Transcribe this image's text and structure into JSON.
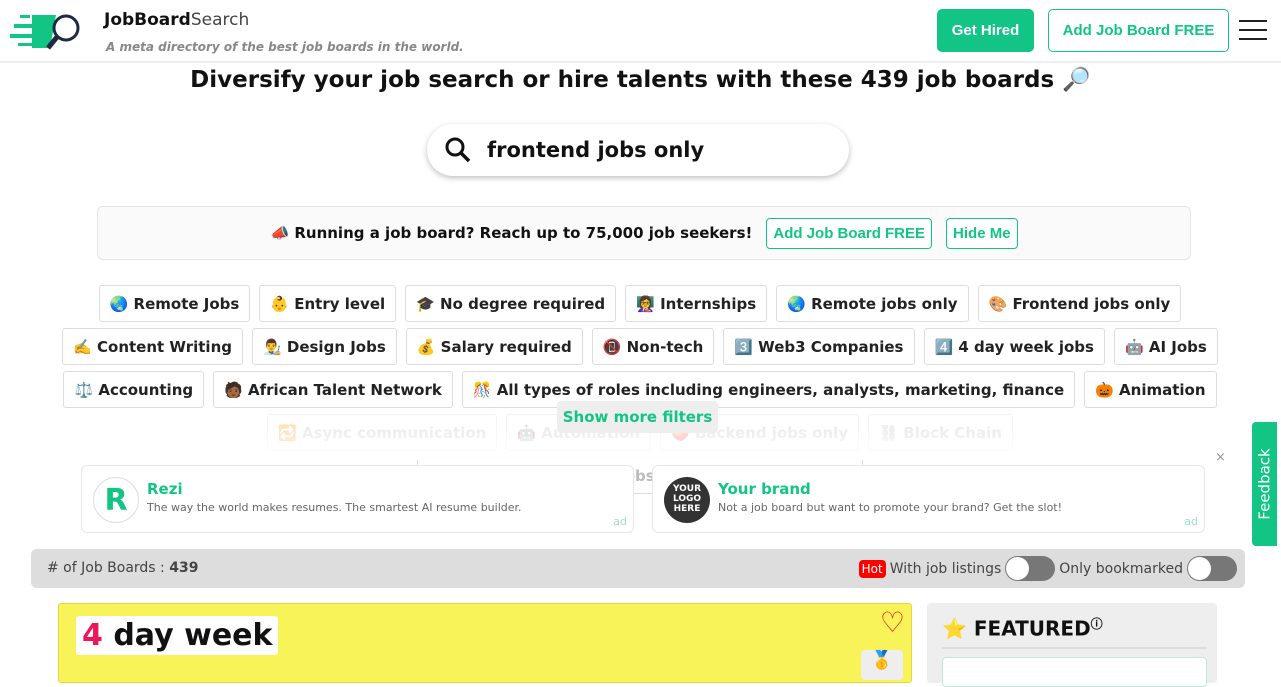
{
  "header": {
    "brand_bold": "JobBoard",
    "brand_light": "Search",
    "tagline": "A meta directory of the best job boards in the world.",
    "get_hired": "Get Hired",
    "add_board": "Add Job Board FREE"
  },
  "hero": {
    "title": "Diversify your job search or hire talents with these 439 job boards 🔎",
    "search_value": "frontend jobs only"
  },
  "promo": {
    "text": "📣 Running a job board? Reach up to 75,000 job seekers!",
    "add": "Add Job Board FREE",
    "hide": "Hide Me"
  },
  "filters": [
    "🌏 Remote Jobs",
    "👶 Entry level",
    "🎓 No degree required",
    "👩‍🏫 Internships",
    "🌏 Remote jobs only",
    "🎨 Frontend jobs only",
    "✍️ Content Writing",
    "👨‍🎨 Design Jobs",
    "💰 Salary required",
    "📵 Non-tech",
    "3️⃣ Web3 Companies",
    "4️⃣ 4 day week jobs",
    "🤖 AI Jobs",
    "⚖️ Accounting",
    "🧑🏾 African Talent Network",
    "🎊 All types of roles including engineers, analysts, marketing, finance",
    "🎃 Animation",
    "🔁 Async communication",
    "🤖 Automation",
    "🍑 Backend jobs only",
    "⛓ Block Chain",
    "✍️ Blog about Remote Jobs and Working Remotely"
  ],
  "show_more": "Show more filters",
  "ads": [
    {
      "title": "Rezi",
      "desc": "The way the world makes resumes. The smartest AI resume builder.",
      "label": "ad"
    },
    {
      "title": "Your brand",
      "desc": "Not a job board but want to promote your brand? Get the slot!",
      "label": "ad",
      "logo_text": "YOUR LOGO HERE"
    }
  ],
  "close": "×",
  "feedback": "Feedback",
  "bar": {
    "count_label": "# of Job Boards :",
    "count": "439",
    "hot": "Hot",
    "with_listings": "With job listings",
    "bookmarked": "Only bookmarked",
    "with_listings_on": false,
    "bookmarked_on": false
  },
  "card": {
    "name_num": "4",
    "name_rest": " day week",
    "medal": "🥇"
  },
  "featured": {
    "title": "FEATURED",
    "sup": "ⓘ",
    "star": "⭐"
  },
  "colors": {
    "accent": "#12c585",
    "card_bg": "#f9f35a",
    "hot": "#ff0000"
  }
}
